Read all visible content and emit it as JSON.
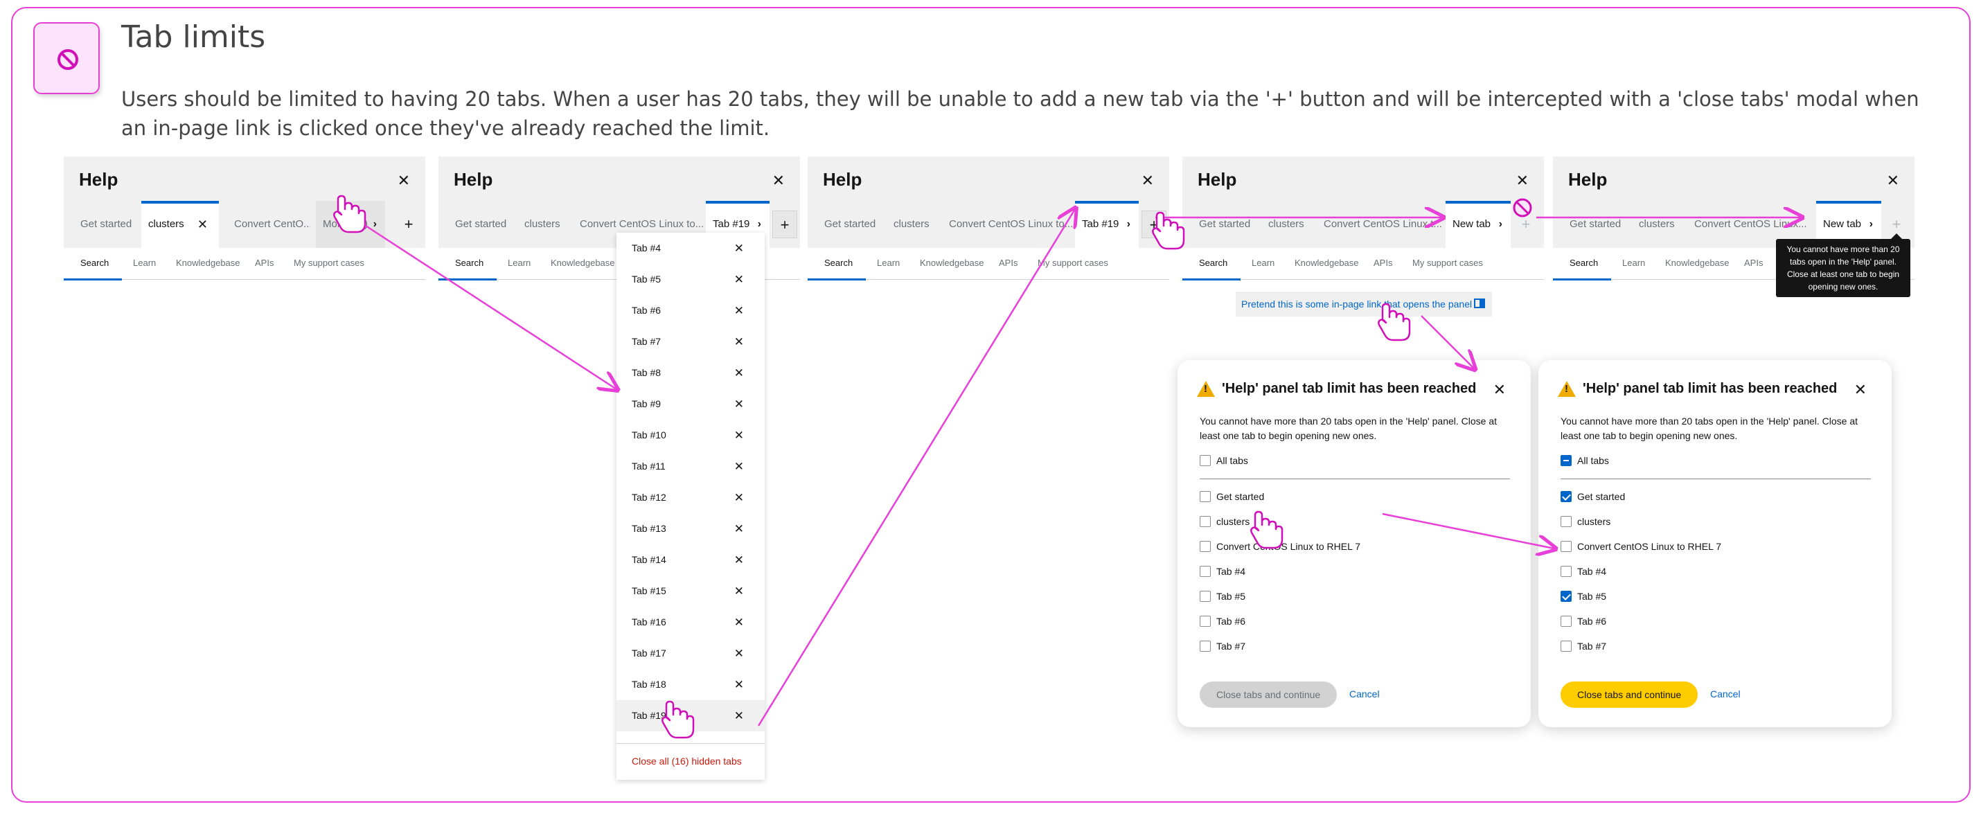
{
  "header": {
    "title": "Tab limits",
    "description": "Users should be limited to having 20 tabs. When a user has 20 tabs, they will be unable to add a new tab via the '+' button and will be intercepted with a 'close tabs' modal when an in-page link is clicked once they've already reached the limit.",
    "icon": "no-entry-icon"
  },
  "colors": {
    "annotation": "#e83fd8",
    "link": "#0066cc",
    "primary_button": "#ffcc00",
    "danger": "#c9190b",
    "warning": "#f0ab00"
  },
  "panels": [
    {
      "title": "Help",
      "tabs": [
        "Get started",
        "clusters",
        "Convert CentO...",
        "More (16)"
      ],
      "active_tab": "clusters",
      "subnav": [
        "Search",
        "Learn",
        "Knowledgebase",
        "APIs",
        "My support cases"
      ]
    },
    {
      "title": "Help",
      "tabs": [
        "Get started",
        "clusters",
        "Convert CentOS Linux to...",
        "Tab #19"
      ],
      "active_tab": "Tab #19",
      "subnav": [
        "Search",
        "Learn",
        "Knowledgebase"
      ]
    },
    {
      "title": "Help",
      "tabs": [
        "Get started",
        "clusters",
        "Convert CentOS Linux to...",
        "Tab #19"
      ],
      "active_tab": "Tab #19",
      "subnav": [
        "Search",
        "Learn",
        "Knowledgebase",
        "APIs",
        "My support cases"
      ]
    },
    {
      "title": "Help",
      "tabs": [
        "Get started",
        "clusters",
        "Convert CentOS Linux t...",
        "New tab"
      ],
      "active_tab": "New tab",
      "subnav": [
        "Search",
        "Learn",
        "Knowledgebase",
        "APIs",
        "My support cases"
      ]
    },
    {
      "title": "Help",
      "tabs": [
        "Get started",
        "clusters",
        "Convert CentOS Linux...",
        "New tab"
      ],
      "active_tab": "New tab",
      "subnav": [
        "Search",
        "Learn",
        "Knowledgebase",
        "APIs"
      ]
    }
  ],
  "dropdown": {
    "items": [
      "Tab #4",
      "Tab #5",
      "Tab #6",
      "Tab #7",
      "Tab #8",
      "Tab #9",
      "Tab #10",
      "Tab #11",
      "Tab #12",
      "Tab #13",
      "Tab #14",
      "Tab #15",
      "Tab #16",
      "Tab #17",
      "Tab #18",
      "Tab #19"
    ],
    "close_all": "Close all (16) hidden tabs"
  },
  "inpage_link": "Pretend this is some in-page link that opens the panel",
  "tooltip": "You cannot have more than 20 tabs open in the 'Help' panel. Close at least one tab to begin opening new ones.",
  "modal": {
    "title": "'Help' panel tab limit has been reached",
    "body": "You cannot have more than 20 tabs open in the 'Help' panel. Close at least one tab to begin opening new ones.",
    "all_tabs": "All tabs",
    "tabs": [
      "Get started",
      "clusters",
      "Convert CentOS Linux to RHEL 7",
      "Tab #4",
      "Tab #5",
      "Tab #6",
      "Tab #7"
    ],
    "primary": "Close tabs and continue",
    "cancel": "Cancel",
    "left_checked": [],
    "right_checked": [
      "Get started",
      "Tab #5"
    ]
  }
}
